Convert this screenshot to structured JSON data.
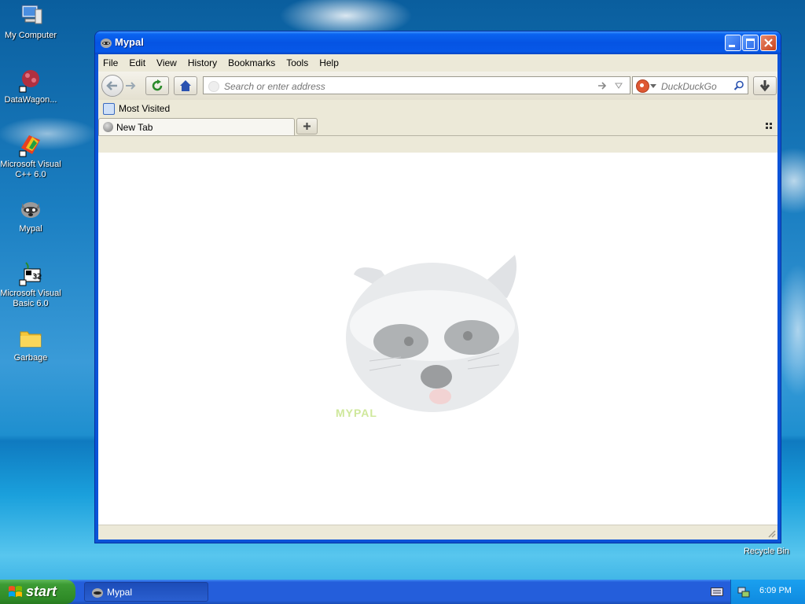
{
  "desktop": {
    "icons": [
      {
        "label": "My Computer"
      },
      {
        "label": "DataWagon..."
      },
      {
        "label": "Microsoft Visual C++ 6.0"
      },
      {
        "label": "Mypal"
      },
      {
        "label": "Microsoft Visual Basic 6.0"
      },
      {
        "label": "Garbage"
      }
    ],
    "recycle_bin": "Recycle Bin"
  },
  "window": {
    "title": "Mypal",
    "menu": [
      "File",
      "Edit",
      "View",
      "History",
      "Bookmarks",
      "Tools",
      "Help"
    ],
    "url_placeholder": "Search or enter address",
    "search_placeholder": "DuckDuckGo",
    "bookmarks_toolbar": {
      "most_visited": "Most Visited"
    },
    "tab": {
      "label": "New Tab"
    },
    "watermark_text": "MYPAL"
  },
  "taskbar": {
    "start_label": "start",
    "task_label": "Mypal",
    "clock": "6:09 PM"
  },
  "colors": {
    "titlebar": "#0554e3",
    "taskbar": "#245edb",
    "start_green": "#3c9b34",
    "content_bg": "#ffffff"
  }
}
